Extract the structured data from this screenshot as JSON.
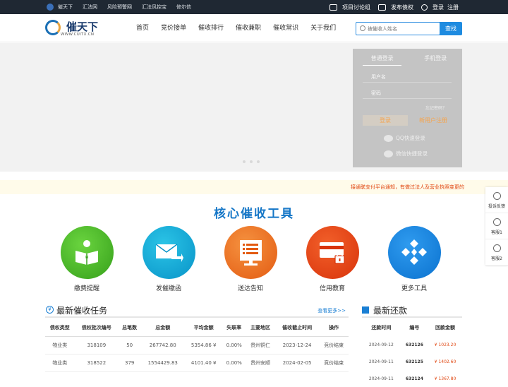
{
  "topbar": {
    "links": [
      "催天下",
      "汇法网",
      "风险预警网",
      "汇法风控宝",
      "修尔信"
    ],
    "right": {
      "discussion": "项目讨论组",
      "publish": "发布债权",
      "login": "登录",
      "register": "注册"
    }
  },
  "header": {
    "logo_name": "催天下",
    "logo_url": "WWW.CUITX.CN",
    "nav": [
      "首页",
      "竞价接单",
      "催收排行",
      "催收兼职",
      "催收常识",
      "关于我们"
    ],
    "search_placeholder": "被催收人姓名",
    "search_button": "查找"
  },
  "login": {
    "tab_normal": "普通登录",
    "tab_mobile": "手机登录",
    "username_placeholder": "用户名",
    "password_placeholder": "密码",
    "forgot": "忘记密码？",
    "login_button": "登录",
    "register_button": "新用户注册",
    "qq_login": "QQ快速登录",
    "wechat_login": "微信快捷登录"
  },
  "ticker": "接通联支付平台通知，有做过法人及营业执照变更的",
  "sidebar": [
    "投诉反馈",
    "客服1",
    "客服2"
  ],
  "section_title": "核心催收工具",
  "tools": [
    {
      "label": "缴费提醒",
      "icon": "book-icon"
    },
    {
      "label": "发催缴函",
      "icon": "envelope-icon"
    },
    {
      "label": "送达告知",
      "icon": "document-icon"
    },
    {
      "label": "信用教育",
      "icon": "credit-card-icon"
    },
    {
      "label": "更多工具",
      "icon": "diamond-grid-icon"
    }
  ],
  "tasks": {
    "title": "最新催收任务",
    "more": "查看更多>>",
    "headers": [
      "债权类型",
      "债权批次编号",
      "总笔数",
      "总金额",
      "平均金额",
      "失联率",
      "主要地区",
      "催收截止时间",
      "操作"
    ],
    "rows": [
      [
        "物业类",
        "318109",
        "50",
        "267742.80",
        "5354.86 ¥",
        "0.00%",
        "贵州铜仁",
        "2023-12-24",
        "竞价结束"
      ],
      [
        "物业类",
        "318522",
        "379",
        "1554429.83",
        "4101.40 ¥",
        "0.00%",
        "贵州安顺",
        "2024-02-05",
        "竞价结束"
      ]
    ]
  },
  "repayments": {
    "title": "最新还款",
    "headers": [
      "还款时间",
      "编号",
      "回款金额"
    ],
    "rows": [
      [
        "2024-09-12",
        "632126",
        "¥ 1023.20"
      ],
      [
        "2024-09-11",
        "632125",
        "¥ 1402.60"
      ],
      [
        "2024-09-11",
        "632124",
        "¥ 1367.80"
      ]
    ]
  },
  "colors": {
    "accent": "#1e8be0",
    "topbar": "#1f2833",
    "highlight": "#e0450f"
  }
}
